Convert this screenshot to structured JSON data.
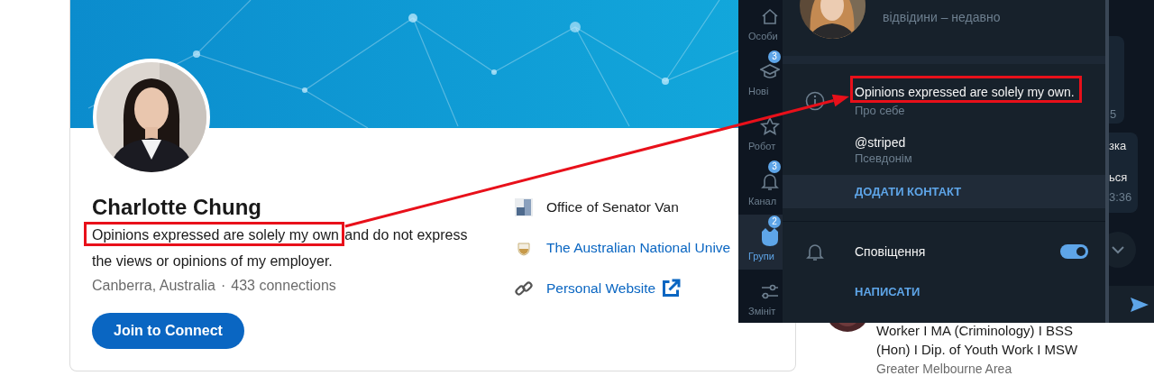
{
  "profile_card": {
    "name": "Charlotte Chung",
    "headline": [
      {
        "text": "Opinions expressed are solely my own",
        "highlighted": true
      },
      {
        "text": "and do not express",
        "highlighted": false
      },
      {
        "text": "the views or opinions of my employer.",
        "highlighted": false
      }
    ],
    "location": "Canberra, Australia",
    "separator": "·",
    "connections": "433 connections",
    "connect_button": "Join to Connect",
    "links": [
      {
        "kind": "company",
        "label": "Office of Senator Van"
      },
      {
        "kind": "school",
        "label": "The Australian National Unive"
      },
      {
        "kind": "website",
        "label": "Personal Website"
      }
    ]
  },
  "side_result": {
    "headline": "Worker I MA (Criminology) I BSS (Hon) I Dip. of Youth Work I MSW",
    "location": "Greater Melbourne Area"
  },
  "telegram": {
    "nav": [
      {
        "kind": "home",
        "label": "Особи",
        "selected": false
      },
      {
        "kind": "cap",
        "label": "Нові",
        "badge": "3",
        "selected": false
      },
      {
        "kind": "star",
        "label": "Робот",
        "selected": false
      },
      {
        "kind": "bell",
        "label": "Канал",
        "badge": "3",
        "selected": false
      },
      {
        "kind": "cat",
        "label": "Групи",
        "badge": "2",
        "selected": true
      },
      {
        "kind": "sliders",
        "label": "Змініт",
        "selected": false
      }
    ],
    "status": "відвідини – недавно",
    "info_rows": [
      {
        "kind": "about",
        "value": "Opinions expressed are solely my own.",
        "caption": "Про себе",
        "highlighted": true
      },
      {
        "kind": "username",
        "value": "@striped",
        "caption": "Псевдонім",
        "highlighted": false
      }
    ],
    "add_contact": {
      "label": "ДОДАТИ КОНТАКТ",
      "hovered": true
    },
    "notifications": {
      "label": "Сповіщення",
      "on": true
    },
    "send_message": "НАПИСАТИ",
    "chat_fragments": [
      "5",
      "зка",
      "ься",
      "3:36"
    ]
  }
}
